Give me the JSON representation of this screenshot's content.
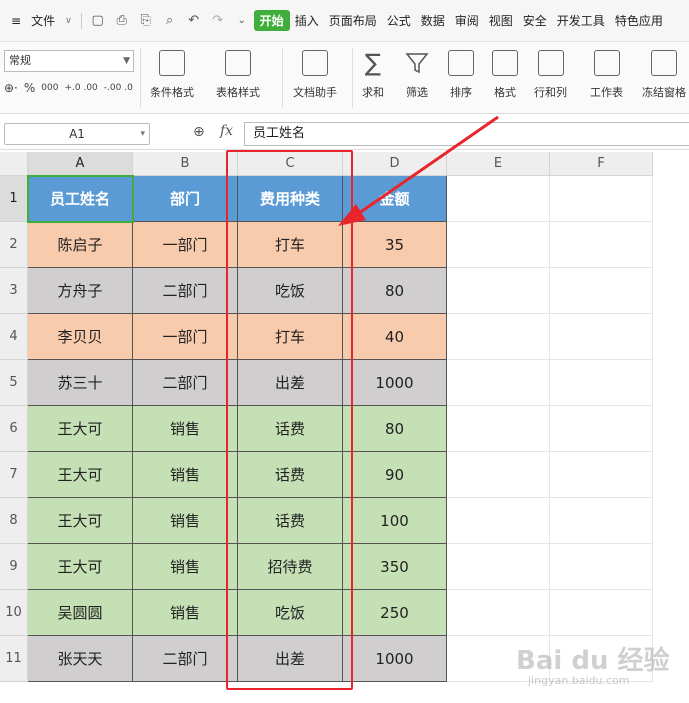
{
  "menubar": {
    "hamburger": "≡",
    "file": "文件",
    "tabs": [
      "开始",
      "插入",
      "页面布局",
      "公式",
      "数据",
      "审阅",
      "视图",
      "安全",
      "开发工具",
      "特色应用"
    ],
    "active_tab": "开始"
  },
  "ribbon": {
    "font_value": "常规",
    "numfmt": [
      "%",
      "000",
      "+.0 .00",
      "-.00 .0"
    ],
    "buttons": [
      "条件格式",
      "表格样式",
      "文档助手",
      "求和",
      "筛选",
      "排序",
      "格式",
      "行和列",
      "工作表",
      "冻结窗格"
    ]
  },
  "formula_bar": {
    "cell_ref": "A1",
    "fx": "fx",
    "value": "员工姓名"
  },
  "columns": [
    "A",
    "B",
    "C",
    "D",
    "E",
    "F"
  ],
  "rows": [
    "1",
    "2",
    "3",
    "4",
    "5",
    "6",
    "7",
    "8",
    "9",
    "10",
    "11"
  ],
  "table": {
    "headers": [
      "员工姓名",
      "部门",
      "费用种类",
      "金额"
    ],
    "rows": [
      {
        "name": "陈启子",
        "dept": "一部门",
        "type": "打车",
        "amount": "35",
        "color": "orange"
      },
      {
        "name": "方舟子",
        "dept": "二部门",
        "type": "吃饭",
        "amount": "80",
        "color": "gray"
      },
      {
        "name": "李贝贝",
        "dept": "一部门",
        "type": "打车",
        "amount": "40",
        "color": "orange"
      },
      {
        "name": "苏三十",
        "dept": "二部门",
        "type": "出差",
        "amount": "1000",
        "color": "gray"
      },
      {
        "name": "王大可",
        "dept": "销售",
        "type": "话费",
        "amount": "80",
        "color": "green"
      },
      {
        "name": "王大可",
        "dept": "销售",
        "type": "话费",
        "amount": "90",
        "color": "green"
      },
      {
        "name": "王大可",
        "dept": "销售",
        "type": "话费",
        "amount": "100",
        "color": "green"
      },
      {
        "name": "王大可",
        "dept": "销售",
        "type": "招待费",
        "amount": "350",
        "color": "green"
      },
      {
        "name": "吴圆圆",
        "dept": "销售",
        "type": "吃饭",
        "amount": "250",
        "color": "green"
      },
      {
        "name": "张天天",
        "dept": "二部门",
        "type": "出差",
        "amount": "1000",
        "color": "gray"
      }
    ]
  },
  "colors": {
    "header": "#5b9bd5",
    "orange": "#f8cbad",
    "gray": "#d0cece",
    "green": "#c5e0b4",
    "highlight": "#e8242d",
    "active_tab": "#3fae3b"
  },
  "watermark": {
    "brand": "Bai du 经验",
    "url": "jingyan.baidu.com"
  }
}
